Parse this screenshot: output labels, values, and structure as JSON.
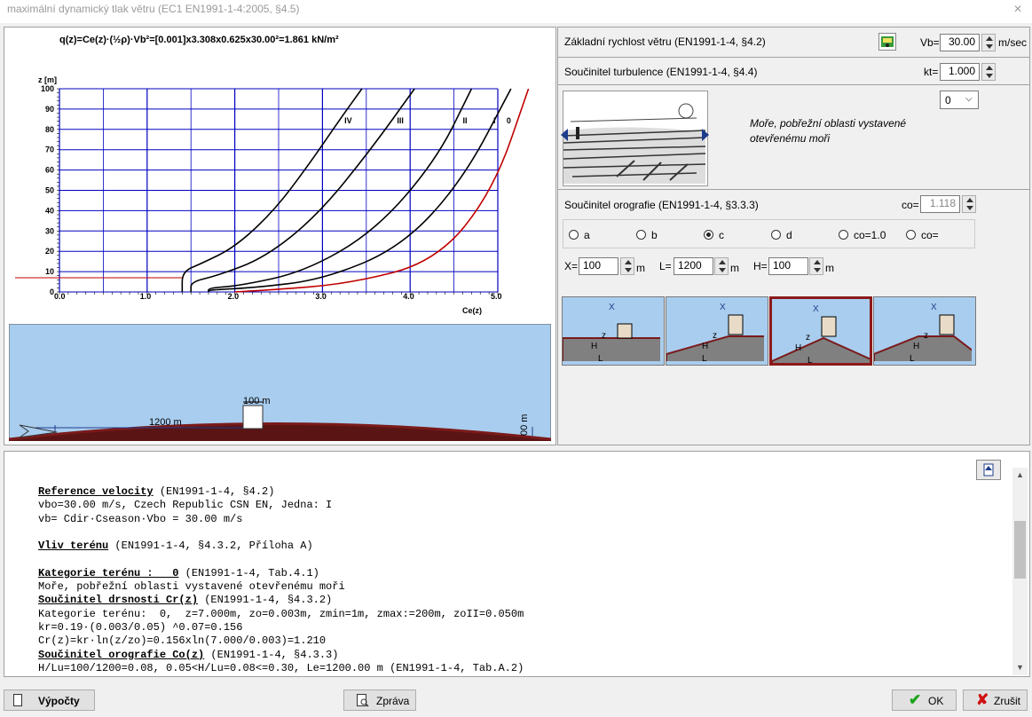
{
  "window": {
    "title": "maximální dynamický tlak větru (EC1 EN1991-1-4:2005, §4.5)",
    "close_label": "×"
  },
  "chart": {
    "formula": "q(z)=Ce(z)·(½ρ)·Vb²=[0.001]x3.308x0.625x30.00²=1.861 kN/m²",
    "ylabel": "z [m]",
    "xlabel": "Ce(z)",
    "x_ticks": [
      "1.0",
      "2.0",
      "3.0",
      "4.0",
      "5.0"
    ],
    "x_origin_label": "0.0",
    "y_ticks": [
      "100",
      "90",
      "80",
      "70",
      "60",
      "50",
      "40",
      "30",
      "20",
      "10",
      "0"
    ],
    "curve_labels": [
      "IV",
      "III",
      "II",
      "I",
      "0"
    ],
    "highlight_color": "#c00000",
    "grid_color": "#0000c0"
  },
  "chart_data": {
    "type": "line",
    "xlabel": "Ce(z)",
    "ylabel": "z [m]",
    "xlim": [
      0.0,
      5.0
    ],
    "ylim": [
      0,
      100
    ],
    "series": [
      {
        "name": "IV",
        "x": [
          1.4,
          1.4,
          1.62,
          2.0,
          2.45,
          2.85,
          3.2,
          3.45
        ],
        "y": [
          0,
          10,
          14,
          22,
          40,
          63,
          85,
          100
        ]
      },
      {
        "name": "III",
        "x": [
          1.5,
          1.5,
          1.8,
          2.35,
          2.95,
          3.55,
          4.05
        ],
        "y": [
          0,
          5,
          8,
          17,
          38,
          70,
          100
        ]
      },
      {
        "name": "II",
        "x": [
          1.7,
          1.7,
          2.05,
          2.8,
          3.6,
          4.3,
          4.7
        ],
        "y": [
          0,
          2,
          3,
          10,
          30,
          65,
          100
        ]
      },
      {
        "name": "I",
        "x": [
          1.7,
          1.7,
          2.2,
          3.0,
          3.9,
          4.6,
          5.15
        ],
        "y": [
          0,
          1,
          2,
          6,
          22,
          55,
          100
        ]
      },
      {
        "name": "0",
        "x": [
          2.0,
          2.4,
          3.3,
          4.3,
          4.95,
          5.35
        ],
        "y": [
          0,
          1,
          4,
          15,
          50,
          100
        ]
      }
    ]
  },
  "terrain_view": {
    "dist_label": "1200 m",
    "height_label": "100 m",
    "edge_label": "00 m"
  },
  "params": {
    "vb_label": "Základní rychlost větru (EN1991-1-4, §4.2)",
    "vb_field_label": "Vb=",
    "vb_value": "30.00",
    "vb_unit": "m/sec",
    "kt_label": "Součinitel turbulence (EN1991-1-4, §4.4)",
    "kt_field_label": "kt=",
    "kt_value": "1.000",
    "category_value": "0",
    "category_desc": "Moře, pobřežní oblasti vystavené otevřenému moři",
    "oro_label": "Součinitel orografie (EN1991-1-4, §3.3.3)",
    "co_field_label": "co=",
    "co_value": "1.118",
    "radios": [
      "a",
      "b",
      "c",
      "d",
      "co=1.0",
      "co="
    ],
    "radio_selected": "c",
    "x_label": "X=",
    "x_value": "100",
    "x_unit": "m",
    "l_label": "L=",
    "l_value": "1200",
    "l_unit": "m",
    "h_label": "H=",
    "h_value": "100",
    "h_unit": "m",
    "thumb_selected_index": 2,
    "thumb_labels": [
      "X",
      "z",
      "H",
      "L"
    ]
  },
  "report": {
    "lines": [
      {
        "text": "Reference velocity",
        "rest": " (EN1991-1-4, §4.2)",
        "bold": true
      },
      {
        "text": "vbo=30.00 m/s, Czech Republic CSN EN, Jedna: I"
      },
      {
        "text": "vb= Cdir·Cseason·Vbo = 30.00 m/s"
      },
      {
        "text": ""
      },
      {
        "text": "Vliv terénu",
        "rest": " (EN1991-1-4, §4.3.2, Příloha A)",
        "bold": true
      },
      {
        "text": ""
      },
      {
        "text": "Kategorie terénu :   0",
        "rest": " (EN1991-1-4, Tab.4.1)",
        "bold": true
      },
      {
        "text": "Moře, pobřežní oblasti vystavené otevřenému moři"
      },
      {
        "text": "Součinitel drsnosti Cr(z)",
        "rest": " (EN1991-1-4, §4.3.2)",
        "bold": true
      },
      {
        "text": "Kategorie terénu:  0,  z=7.000m, zo=0.003m, zmin=1m, zmax:=200m, zoII=0.050m"
      },
      {
        "text": "kr=0.19·(0.003/0.05) ^0.07=0.156"
      },
      {
        "text": "Cr(z)=kr·ln(z/zo)=0.156xln(7.000/0.003)=1.210"
      },
      {
        "text": "Součinitel orografie Co(z)",
        "rest": " (EN1991-1-4, §4.3.3)",
        "bold": true
      },
      {
        "text": "H/Lu=100/1200=0.08, 0.05<H/Lu=0.08<=0.30, Le=1200.00 m (EN1991-1-4, Tab.A.2)"
      }
    ]
  },
  "buttons": {
    "calc": "Výpočty",
    "report": "Zpráva",
    "ok": "OK",
    "cancel": "Zrušit"
  },
  "icons": {
    "calc": "calculator-icon",
    "report": "report-preview-icon",
    "ok": "check-icon",
    "cancel": "x-icon",
    "export": "export-icon",
    "settings": "map-settings-icon"
  }
}
